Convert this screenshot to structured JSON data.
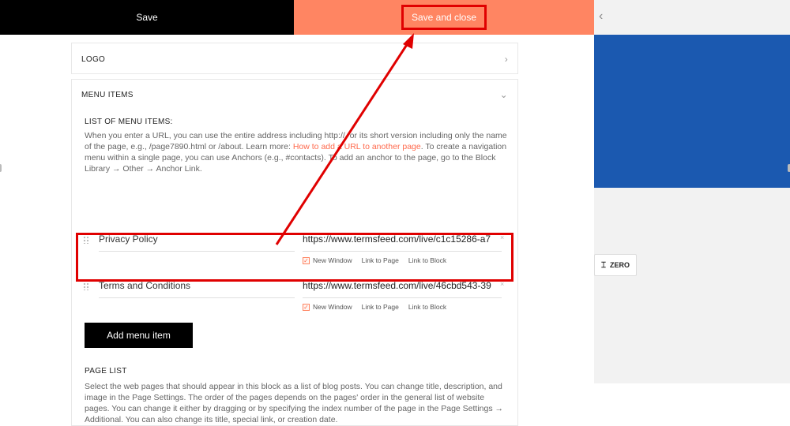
{
  "topbar": {
    "save_label": "Save",
    "save_close_label": "Save and close",
    "save_close_color": "#ff8562"
  },
  "logo_section": {
    "title": "LOGO"
  },
  "menu_section": {
    "title": "MENU ITEMS",
    "list_title": "LIST OF MENU ITEMS:",
    "description_pre": "When you enter a URL, you can use the entire address including http://, or its short version including only the name of the page, e.g., /page7890.html or /about. Learn more: ",
    "description_link": "How to add a URL to another page",
    "description_post": ". To create a navigation menu within a single page, you can use Anchors (e.g., #contacts). To add an anchor to the page, go to the Block Library → Other → Anchor Link.",
    "items": [
      {
        "title": "Privacy Policy",
        "url": "https://www.termsfeed.com/live/c1c15286-a7",
        "options": [
          "New Window",
          "Link to Page",
          "Link to Block"
        ]
      },
      {
        "title": "Terms and Conditions",
        "url": "https://www.termsfeed.com/live/46cbd543-39",
        "options": [
          "New Window",
          "Link to Page",
          "Link to Block"
        ]
      }
    ],
    "add_button_label": "Add menu item"
  },
  "page_list": {
    "title": "PAGE LIST",
    "description": "Select the web pages that should appear in this block as a list of blog posts. You can change title, description, and image in the Page Settings. The order of the pages depends on the pages' order in the general list of website pages. You can change it either by dragging or by specifying the index number of the page in the Page Settings → Additional. You can also change its title, special link, or creation date."
  },
  "right_panel": {
    "zero_label": "ZERO",
    "blue_color": "#1b59b0"
  },
  "annotation_color": "#e00000"
}
